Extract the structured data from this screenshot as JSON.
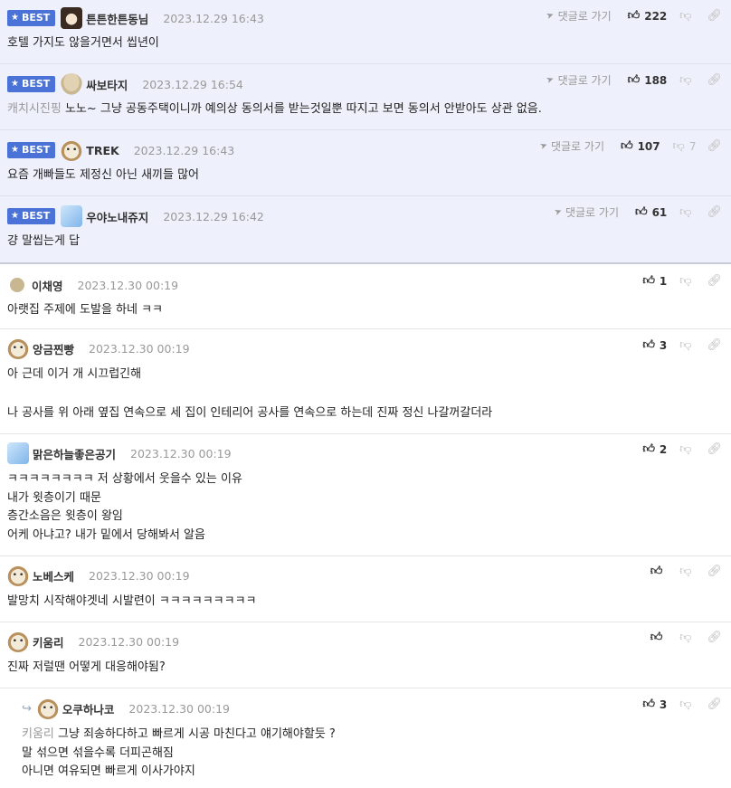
{
  "best_badge": "BEST",
  "reply_label": "댓글로 가기",
  "comments": [
    {
      "name": "튼튼한튼동님",
      "date": "2023.12.29 16:43",
      "likes": "222",
      "dislikes": "",
      "text": "호텔 가지도 않을거면서 씹년이",
      "avatar": "bear-avatar"
    },
    {
      "name": "싸보타지",
      "date": "2023.12.29 16:54",
      "likes": "188",
      "dislikes": "",
      "mention": "캐치시진핑",
      "text": "노노~ 그냥 공동주택이니까 예의상 동의서를 받는것일뿐 따지고 보면 동의서 안받아도 상관 없음.",
      "avatar": "mushroom-avatar"
    },
    {
      "name": "TREK",
      "date": "2023.12.29 16:43",
      "likes": "107",
      "dislikes": "7",
      "text": "요즘 개빠들도 제정신 아닌 새끼들 많어",
      "avatar": "dog-avatar"
    },
    {
      "name": "우야노내쥬지",
      "date": "2023.12.29 16:42",
      "likes": "61",
      "dislikes": "",
      "text": "걍 말씹는게 답",
      "avatar": "bird-avatar"
    },
    {
      "name": "이채영",
      "date": "2023.12.30 00:19",
      "likes": "1",
      "dislikes": "",
      "text": "아랫집 주제에 도발을 하네 ㅋㅋ",
      "avatar": "small-avatar"
    },
    {
      "name": "앙금찐빵",
      "date": "2023.12.30 00:19",
      "likes": "3",
      "dislikes": "",
      "lines": [
        "아 근데 이거 개 시끄럽긴해",
        "",
        "나 공사를 위 아래 옆집 연속으로 세 집이 인테리어 공사를 연속으로 하는데 진짜 정신 나갈꺼갈더라"
      ],
      "avatar": "dog-avatar"
    },
    {
      "name": "맑은하늘좋은공기",
      "date": "2023.12.30 00:19",
      "likes": "2",
      "dislikes": "",
      "lines": [
        "ㅋㅋㅋㅋㅋㅋㅋㅋ 저 상황에서 웃을수 있는 이유",
        "내가 윗층이기 때문",
        "층간소음은 윗층이 왕임",
        "어케 아냐고? 내가 밑에서 당해봐서 알음"
      ],
      "avatar": "bird-avatar"
    },
    {
      "name": "노베스케",
      "date": "2023.12.30 00:19",
      "likes": "",
      "dislikes": "",
      "text": "발망치 시작해야겟네 시발련이 ㅋㅋㅋㅋㅋㅋㅋㅋㅋ",
      "avatar": "dog-avatar"
    },
    {
      "name": "키움리",
      "date": "2023.12.30 00:19",
      "likes": "",
      "dislikes": "",
      "text": "진짜 저럴땐 어떻게 대응해야됨?",
      "avatar": "dog-avatar"
    },
    {
      "name": "오쿠하나코",
      "date": "2023.12.30 00:19",
      "likes": "3",
      "dislikes": "",
      "mention": "키움리",
      "lines": [
        "그냥 죄송하다하고 빠르게 시공 마친다고 얘기해야할듯 ?",
        "말 섞으면 섞을수록 더피곤해짐",
        "아니면 여유되면 빠르게 이사가야지"
      ],
      "avatar": "dog-avatar"
    }
  ]
}
